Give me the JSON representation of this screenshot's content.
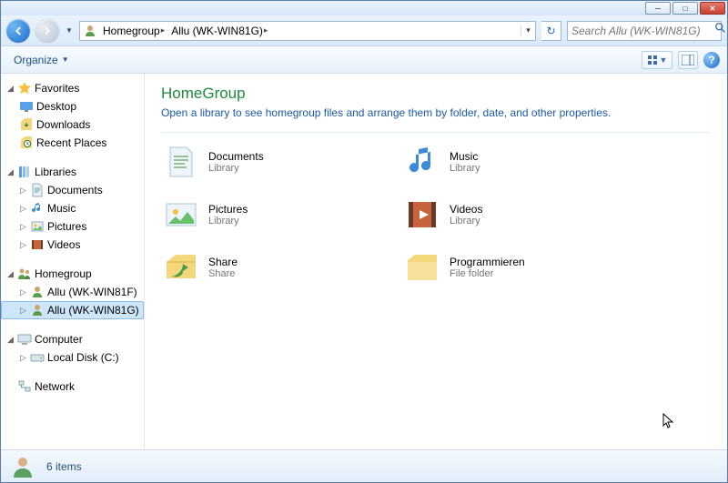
{
  "window_controls": {
    "min": "─",
    "max": "□",
    "close": "✕"
  },
  "breadcrumb": {
    "items": [
      {
        "label": "Homegroup"
      },
      {
        "label": "Allu (WK-WIN81G)"
      }
    ]
  },
  "search": {
    "placeholder": "Search Allu (WK-WIN81G)"
  },
  "toolbar": {
    "organize": "Organize"
  },
  "sidebar": {
    "favorites": {
      "label": "Favorites",
      "items": [
        {
          "label": "Desktop"
        },
        {
          "label": "Downloads"
        },
        {
          "label": "Recent Places"
        }
      ]
    },
    "libraries": {
      "label": "Libraries",
      "items": [
        {
          "label": "Documents"
        },
        {
          "label": "Music"
        },
        {
          "label": "Pictures"
        },
        {
          "label": "Videos"
        }
      ]
    },
    "homegroup": {
      "label": "Homegroup",
      "items": [
        {
          "label": "Allu (WK-WIN81F)"
        },
        {
          "label": "Allu (WK-WIN81G)",
          "selected": true
        }
      ]
    },
    "computer": {
      "label": "Computer",
      "items": [
        {
          "label": "Local Disk (C:)"
        }
      ]
    },
    "network": {
      "label": "Network"
    }
  },
  "main": {
    "title": "HomeGroup",
    "subtitle": "Open a library to see homegroup files and arrange them by folder, date, and other properties.",
    "items": [
      {
        "name": "Documents",
        "type": "Library",
        "icon": "documents"
      },
      {
        "name": "Music",
        "type": "Library",
        "icon": "music"
      },
      {
        "name": "Pictures",
        "type": "Library",
        "icon": "pictures"
      },
      {
        "name": "Videos",
        "type": "Library",
        "icon": "videos"
      },
      {
        "name": "Share",
        "type": "Share",
        "icon": "share"
      },
      {
        "name": "Programmieren",
        "type": "File folder",
        "icon": "folder"
      }
    ]
  },
  "status": {
    "text": "6 items"
  }
}
